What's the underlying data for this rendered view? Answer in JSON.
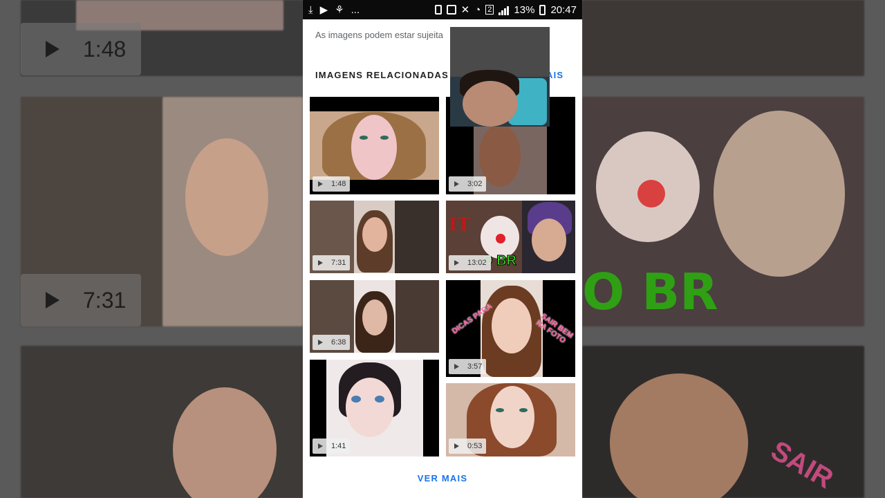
{
  "status_bar": {
    "ellipsis": "...",
    "sim": "2",
    "battery": "13%",
    "time": "20:47"
  },
  "disclaimer": "As imagens podem estar sujeita",
  "related": {
    "title": "IMAGENS RELACIONADAS",
    "see_more_partial": "AIS"
  },
  "videos": [
    {
      "duration": "1:48"
    },
    {
      "duration": "3:02"
    },
    {
      "duration": "7:31"
    },
    {
      "duration": "13:02"
    },
    {
      "duration": "6:38"
    },
    {
      "duration": "3:57"
    },
    {
      "duration": "1:41"
    },
    {
      "duration": "0:53"
    }
  ],
  "thumb_overlays": {
    "it_logo": "IT",
    "br_text": "O BR",
    "dicas": "DICAS PARA",
    "sair": "SAIR BEM NA FOTO"
  },
  "ver_mais": "VER MAIS",
  "background": {
    "durations": [
      "1:48",
      "7:31"
    ],
    "green_text": "O BR",
    "pink_text": "SAIR"
  },
  "colors": {
    "link_blue": "#1a73e8",
    "status_bar": "#0b0b0b",
    "page_bg": "#ffffff"
  }
}
